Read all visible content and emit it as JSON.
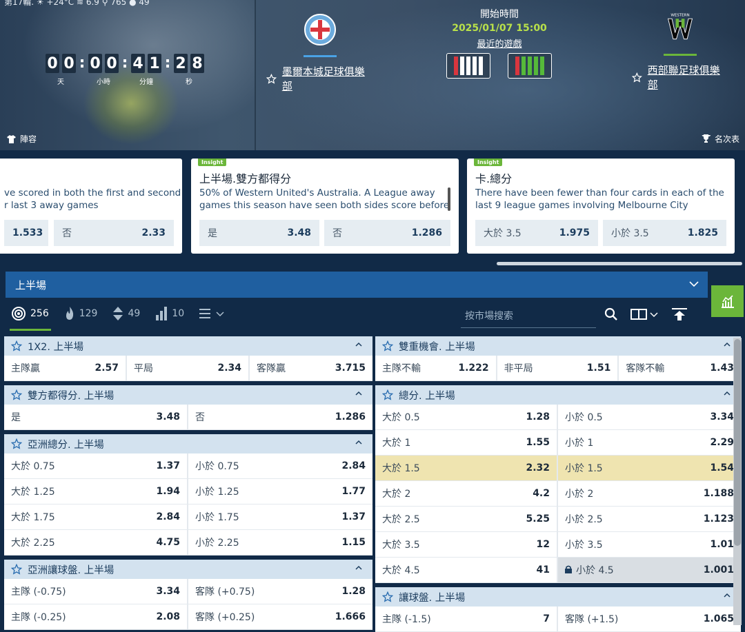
{
  "weather": {
    "text": "第17輪.  ☀ +24°C  ≋ 6.9  ⚲ 765  ● 49"
  },
  "countdown": {
    "days": [
      "0",
      "0"
    ],
    "hours": [
      "0",
      "0"
    ],
    "minutes": [
      "4",
      "1"
    ],
    "seconds": [
      "2",
      "8"
    ],
    "labels": {
      "days": "天",
      "hours": "小時",
      "minutes": "分鐘",
      "seconds": "秒"
    }
  },
  "hero": {
    "lineup": "陣容",
    "standings": "名次表"
  },
  "home_team": {
    "name": "墨爾本城足球俱樂部",
    "underline_color": "#4aa3e6"
  },
  "away_team": {
    "name": "西部聯足球俱樂部",
    "underline_color": "#6bb63a"
  },
  "match": {
    "start_label": "開始時間",
    "start_time": "2025/01/07 15:00",
    "recent_label": "最近的遊戲"
  },
  "form": {
    "home": [
      "r",
      "w",
      "w",
      "w",
      "w"
    ],
    "away": [
      "r",
      "g",
      "g",
      "g",
      "g"
    ]
  },
  "insights": [
    {
      "text1": "ve scored in both the first and second",
      "text2": "r last 3 away games",
      "odds": [
        {
          "label": "",
          "value": "1.533"
        },
        {
          "label": "否",
          "value": "2.33"
        }
      ]
    },
    {
      "tag": "Insight",
      "title": "上半場.雙方都得分",
      "text1": "50% of Western United's Australia. A League away",
      "text2": "games this season have seen both sides score before",
      "odds": [
        {
          "label": "是",
          "value": "3.48"
        },
        {
          "label": "否",
          "value": "1.286"
        }
      ]
    },
    {
      "tag": "Insight",
      "title": "卡.總分",
      "text1": "There have been fewer than four cards in each of the",
      "text2": "last 9 league games involving Melbourne City",
      "odds": [
        {
          "label": "大於 3.5",
          "value": "1.975"
        },
        {
          "label": "小於 3.5",
          "value": "1.825"
        }
      ]
    }
  ],
  "section": {
    "title": "上半場"
  },
  "filters": [
    {
      "icon": "target-icon",
      "count": "256"
    },
    {
      "icon": "fire-icon",
      "count": "129"
    },
    {
      "icon": "updown-icon",
      "count": "49"
    },
    {
      "icon": "bars-icon",
      "count": "10"
    }
  ],
  "search": {
    "placeholder": "按市場搜索"
  },
  "left_markets": [
    {
      "title": "1X2. 上半場",
      "rows": [
        [
          [
            "主隊贏",
            "2.57"
          ],
          [
            "平局",
            "2.34"
          ],
          [
            "客隊贏",
            "3.715"
          ]
        ]
      ]
    },
    {
      "title": "雙方都得分. 上半場",
      "rows": [
        [
          [
            "是",
            "3.48"
          ],
          [
            "否",
            "1.286"
          ]
        ]
      ]
    },
    {
      "title": "亞洲總分. 上半場",
      "rows": [
        [
          [
            "大於 0.75",
            "1.37"
          ],
          [
            "小於 0.75",
            "2.84"
          ]
        ],
        [
          [
            "大於 1.25",
            "1.94"
          ],
          [
            "小於 1.25",
            "1.77"
          ]
        ],
        [
          [
            "大於 1.75",
            "2.84"
          ],
          [
            "小於 1.75",
            "1.37"
          ]
        ],
        [
          [
            "大於 2.25",
            "4.75"
          ],
          [
            "小於 2.25",
            "1.15"
          ]
        ]
      ]
    },
    {
      "title": "亞洲讓球盤. 上半場",
      "rows": [
        [
          [
            "主隊 (-0.75)",
            "3.34"
          ],
          [
            "客隊 (+0.75)",
            "1.28"
          ]
        ],
        [
          [
            "主隊 (-0.25)",
            "2.08"
          ],
          [
            "客隊 (+0.25)",
            "1.666"
          ]
        ]
      ]
    }
  ],
  "right_markets": [
    {
      "title": "雙重機會. 上半場",
      "rows": [
        [
          [
            "主隊不輸",
            "1.222"
          ],
          [
            "非平局",
            "1.51"
          ],
          [
            "客隊不輸",
            "1.43"
          ]
        ]
      ]
    },
    {
      "title": "總分. 上半場",
      "rows": [
        [
          [
            "大於 0.5",
            "1.28"
          ],
          [
            "小於 0.5",
            "3.34"
          ]
        ],
        [
          [
            "大於 1",
            "1.55"
          ],
          [
            "小於 1",
            "2.29"
          ]
        ],
        [
          [
            "大於 1.5",
            "2.32"
          ],
          [
            "小於 1.5",
            "1.54"
          ]
        ],
        [
          [
            "大於 2",
            "4.2"
          ],
          [
            "小於 2",
            "1.188"
          ]
        ],
        [
          [
            "大於 2.5",
            "5.25"
          ],
          [
            "小於 2.5",
            "1.123"
          ]
        ],
        [
          [
            "大於 3.5",
            "12"
          ],
          [
            "小於 3.5",
            "1.01"
          ]
        ],
        [
          [
            "大於 4.5",
            "41"
          ],
          [
            "小於 4.5",
            "1.001"
          ]
        ]
      ]
    },
    {
      "title": "讓球盤. 上半場",
      "rows": [
        [
          [
            "主隊 (-1.5)",
            "7"
          ],
          [
            "客隊 (+1.5)",
            "1.065"
          ]
        ]
      ]
    }
  ]
}
